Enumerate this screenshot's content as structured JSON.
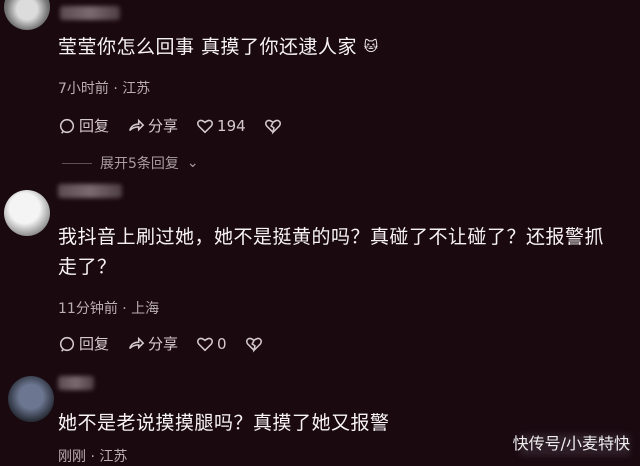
{
  "colors": {
    "background": "#1b0910",
    "text": "#f7f3f4",
    "meta": "#b9aeb2"
  },
  "comments": [
    {
      "text": "莹莹你怎么回事 真摸了你还逮人家",
      "emoji": "cat-emoji",
      "meta": "7小时前 · 江苏",
      "reply_label": "回复",
      "share_label": "分享",
      "like_count": "194",
      "expand_label": "展开5条回复"
    },
    {
      "text": "我抖音上刷过她，她不是挺黄的吗？真碰了不让碰了？还报警抓走了？",
      "meta": "11分钟前 · 上海",
      "reply_label": "回复",
      "share_label": "分享",
      "like_count": "0"
    },
    {
      "text": "她不是老说摸摸腿吗？真摸了她又报警",
      "meta": "刚刚 · 江苏"
    }
  ],
  "watermark": "快传号/小麦特快"
}
